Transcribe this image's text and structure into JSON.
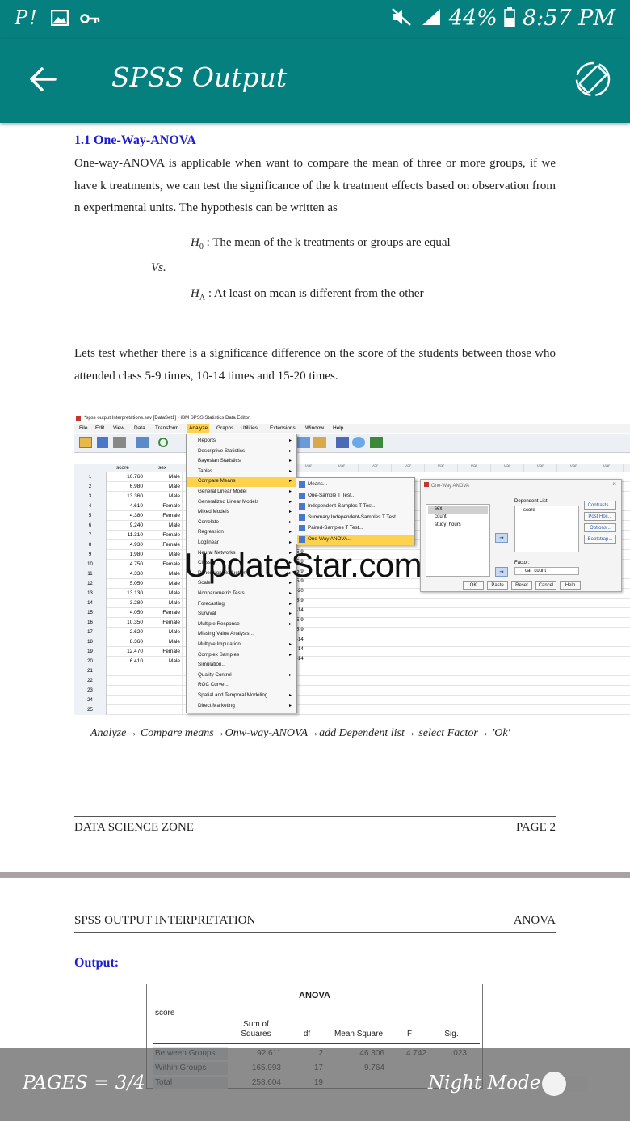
{
  "status_bar": {
    "left_icons": "P!",
    "battery": "44%",
    "time": "8:57 PM"
  },
  "app_bar": {
    "title": "SPSS Output"
  },
  "doc": {
    "section_heading": "1.1 One-Way-ANOVA",
    "intro": "One-way-ANOVA is applicable when want to compare the mean of three or more groups, if we have k treatments, we can test the significance of the k treatment effects based on observation from n experimental units. The hypothesis can be written as",
    "h0_sym": "H",
    "h0_sub": "0",
    "h0_text": ": The mean of the k treatments or groups are equal",
    "vs": "Vs.",
    "ha_sym": "H",
    "ha_sub": "A",
    "ha_text": ": At least on mean is different from the other",
    "test_para": "Lets test whether there is a significance difference on the score of the students between those who attended class 5-9 times, 10-14 times and 15-20 times.",
    "caption": "Analyze→ Compare means→Onw-way-ANOVA→add Dependent list→ select Factor→ 'Ok'",
    "footer_left": "DATA SCIENCE ZONE",
    "footer_right": "PAGE 2",
    "header2_left": "SPSS OUTPUT INTERPRETATION",
    "header2_right": "ANOVA",
    "output_label": "Output:"
  },
  "spss": {
    "window_title": "*spss output Interpretations.sav [DataSet1] - IBM SPSS Statistics Data Editor",
    "menubar": [
      "File",
      "Edit",
      "View",
      "Data",
      "Transform",
      "Analyze",
      "Graphs",
      "Utilities",
      "Extensions",
      "Window",
      "Help"
    ],
    "col_headers": [
      "score",
      "sex"
    ],
    "rows": [
      [
        "1",
        "10.760",
        "Male"
      ],
      [
        "2",
        "6.980",
        "Male"
      ],
      [
        "3",
        "13.360",
        "Male"
      ],
      [
        "4",
        "4.610",
        "Female"
      ],
      [
        "5",
        "4.380",
        "Female"
      ],
      [
        "6",
        "9.240",
        "Male"
      ],
      [
        "7",
        "11.310",
        "Female"
      ],
      [
        "8",
        "4.930",
        "Female"
      ],
      [
        "9",
        "1.980",
        "Male"
      ],
      [
        "10",
        "4.750",
        "Female"
      ],
      [
        "11",
        "4.330",
        "Male"
      ],
      [
        "12",
        "5.050",
        "Male"
      ],
      [
        "13",
        "13.130",
        "Male"
      ],
      [
        "14",
        "3.280",
        "Male"
      ],
      [
        "15",
        "4.050",
        "Female"
      ],
      [
        "16",
        "10.350",
        "Female"
      ],
      [
        "17",
        "2.620",
        "Male"
      ],
      [
        "18",
        "8.360",
        "Male"
      ],
      [
        "19",
        "12.470",
        "Female"
      ],
      [
        "20",
        "6.410",
        "Male"
      ],
      [
        "21",
        "",
        ""
      ],
      [
        "22",
        "",
        ""
      ],
      [
        "23",
        "",
        ""
      ],
      [
        "24",
        "",
        ""
      ],
      [
        "25",
        "",
        ""
      ]
    ],
    "analyze_menu": [
      "Reports",
      "Descriptive Statistics",
      "Bayesian Statistics",
      "Tables",
      "Compare Means",
      "General Linear Model",
      "Generalized Linear Models",
      "Mixed Models",
      "Correlate",
      "Regression",
      "Loglinear",
      "Neural Networks",
      "Classify",
      "Dimension Reduction",
      "Scale",
      "Nonparametric Tests",
      "Forecasting",
      "Survival",
      "Multiple Response",
      "Missing Value Analysis...",
      "Multiple Imputation",
      "Complex Samples",
      "Simulation...",
      "Quality Control",
      "ROC Curve...",
      "Spatial and Temporal Modeling...",
      "Direct Marketing"
    ],
    "compare_means_menu": [
      "Means...",
      "One-Sample T Test...",
      "Independent-Samples T Test...",
      "Summary Independent-Samples T Test",
      "Paired-Samples T Test...",
      "One-Way ANOVA..."
    ],
    "var_label": "var",
    "var_count_values": [
      "5-9",
      "5-9",
      "5-9",
      "5-9",
      "-20",
      "5-9",
      "-14",
      "5-9",
      "5-9",
      "-14",
      "-14",
      "-14"
    ],
    "dialog": {
      "title": "One-Way ANOVA",
      "variables": [
        "sex",
        "count",
        "study_hours"
      ],
      "dependent_label": "Dependent List:",
      "dependent_items": [
        "score"
      ],
      "factor_label": "Factor:",
      "factor_value": "cat_count",
      "side_buttons": [
        "Contrasts...",
        "Post Hoc...",
        "Options...",
        "Bootstrap..."
      ],
      "bottom_buttons": [
        "OK",
        "Paste",
        "Reset",
        "Cancel",
        "Help"
      ]
    },
    "watermark": "UpdateStar.com"
  },
  "anova_table": {
    "title": "ANOVA",
    "dv": "score",
    "headers": [
      "Sum of Squares",
      "df",
      "Mean Square",
      "F",
      "Sig."
    ],
    "rows": [
      {
        "label": "Between Groups",
        "ss": "92.611",
        "df": "2",
        "ms": "46.306",
        "f": "4.742",
        "sig": ".023"
      },
      {
        "label": "Within Groups",
        "ss": "165.993",
        "df": "17",
        "ms": "9.764",
        "f": "",
        "sig": ""
      },
      {
        "label": "Total",
        "ss": "258.604",
        "df": "19",
        "ms": "",
        "f": "",
        "sig": ""
      }
    ]
  },
  "bottom_bar": {
    "pages": "PAGES = 3/4",
    "night_mode": "Night Mode",
    "night_mode_on": false
  },
  "colors": {
    "teal": "#067f7f",
    "heading_blue": "#1c1cd0",
    "highlight": "#ffd24d"
  }
}
